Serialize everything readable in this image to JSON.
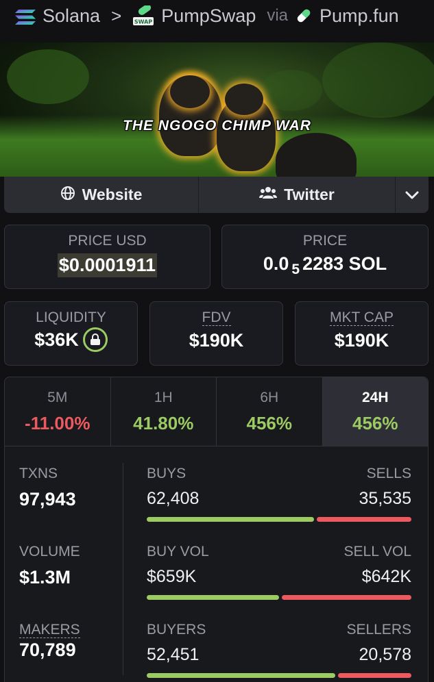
{
  "breadcrumb": {
    "chain": "Solana",
    "separator": ">",
    "dex": "PumpSwap",
    "via": "via",
    "launchpad": "Pump.fun",
    "dex_logo_text": "SWAP"
  },
  "banner": {
    "title": "THE NGOGO CHIMP WAR"
  },
  "links": {
    "website_label": "Website",
    "twitter_label": "Twitter",
    "website_icon": "globe-icon",
    "twitter_icon": "users-icon",
    "more_icon": "chevron-down-icon"
  },
  "price_usd": {
    "label": "PRICE USD",
    "value": "$0.0001911"
  },
  "price": {
    "label": "PRICE",
    "prefix": "0.0",
    "zeros_subscript": "5",
    "digits": "2283",
    "unit": "SOL"
  },
  "liquidity": {
    "label": "LIQUIDITY",
    "value": "$36K",
    "icon": "lock-icon"
  },
  "fdv": {
    "label": "FDV",
    "value": "$190K"
  },
  "mkt_cap": {
    "label": "MKT CAP",
    "value": "$190K"
  },
  "timeframes": [
    {
      "label": "5M",
      "change": "-11.00%",
      "direction": "down"
    },
    {
      "label": "1H",
      "change": "41.80%",
      "direction": "up"
    },
    {
      "label": "6H",
      "change": "456%",
      "direction": "up"
    },
    {
      "label": "24H",
      "change": "456%",
      "direction": "up",
      "selected": true
    }
  ],
  "stats": {
    "txns": {
      "label": "TXNS",
      "value": "97,943"
    },
    "volume": {
      "label": "VOLUME",
      "value": "$1.3M"
    },
    "makers": {
      "label": "MAKERS",
      "value": "70,789"
    },
    "buys": {
      "label": "BUYS",
      "value": "62,408",
      "share": 0.637
    },
    "sells": {
      "label": "SELLS",
      "value": "35,535"
    },
    "buy_vol": {
      "label": "BUY VOL",
      "value": "$659K",
      "share": 0.506
    },
    "sell_vol": {
      "label": "SELL VOL",
      "value": "$642K"
    },
    "buyers": {
      "label": "BUYERS",
      "value": "52,451",
      "share": 0.718
    },
    "sellers": {
      "label": "SELLERS",
      "value": "20,578"
    }
  },
  "colors": {
    "background": "#111114",
    "positive": "#9ccb63",
    "negative": "#ec5a5f",
    "card_border": "#33343b"
  }
}
